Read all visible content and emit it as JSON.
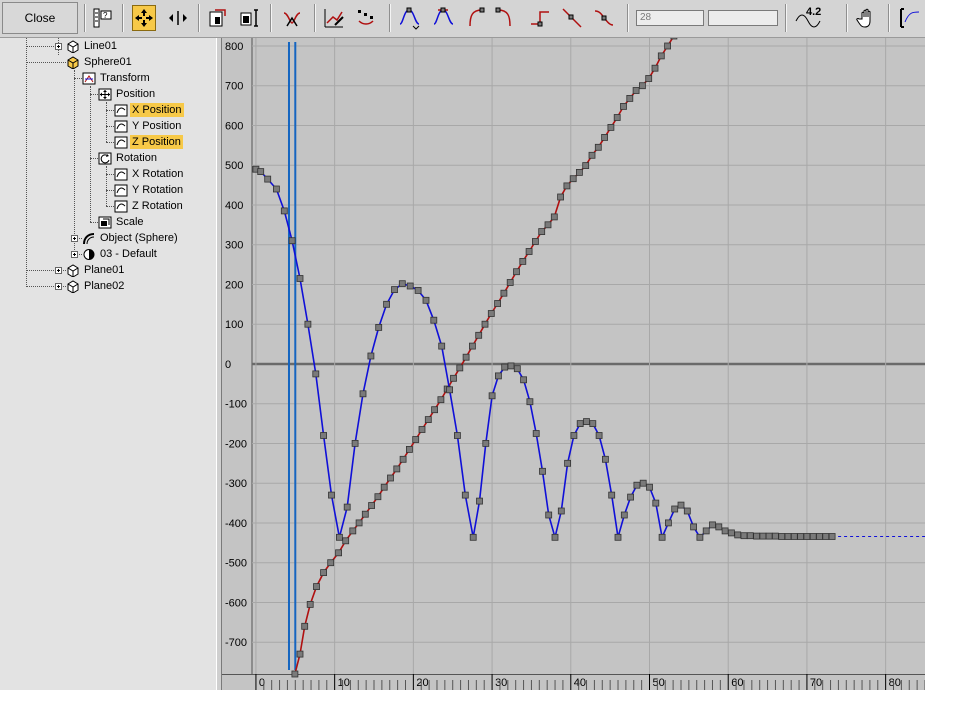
{
  "toolbar": {
    "close_label": "Close",
    "frame_field_value": "28",
    "value_field_value": "",
    "bounce_value": "4.2"
  },
  "tree": {
    "items": [
      {
        "label": "Line01",
        "selected": false
      },
      {
        "label": "Sphere01",
        "selected": false
      },
      {
        "label": "Transform",
        "selected": false
      },
      {
        "label": "Position",
        "selected": false
      },
      {
        "label": "X Position",
        "selected": true
      },
      {
        "label": "Y Position",
        "selected": false
      },
      {
        "label": "Z Position",
        "selected": true
      },
      {
        "label": "Rotation",
        "selected": false
      },
      {
        "label": "X Rotation",
        "selected": false
      },
      {
        "label": "Y Rotation",
        "selected": false
      },
      {
        "label": "Z Rotation",
        "selected": false
      },
      {
        "label": "Scale",
        "selected": false
      },
      {
        "label": "Object (Sphere)",
        "selected": false
      },
      {
        "label": "03 - Default",
        "selected": false
      },
      {
        "label": "Plane01",
        "selected": false
      },
      {
        "label": "Plane02",
        "selected": false
      }
    ]
  },
  "chart_data": {
    "type": "line",
    "xlim": [
      -0.5,
      85
    ],
    "ylim": [
      -780,
      820
    ],
    "x_ticks": [
      0,
      10,
      20,
      30,
      40,
      50,
      60,
      70,
      80
    ],
    "y_ticks": [
      800,
      700,
      600,
      500,
      400,
      300,
      200,
      100,
      0,
      -100,
      -200,
      -300,
      -400,
      -500,
      -600,
      -700
    ],
    "time_slider_frames": [
      4.2,
      5.0
    ],
    "colors": {
      "x_position": "#b01010",
      "z_position": "#1010d8",
      "key": "#7a7a7a",
      "time_line": "#1565c0"
    },
    "series": [
      {
        "key": "x_position",
        "x": [
          4.95,
          5.6,
          6.2,
          6.9,
          7.7,
          8.6,
          9.5,
          10.5,
          11.4,
          12.3,
          13.1,
          13.9,
          14.7,
          15.5,
          16.3,
          17.1,
          17.9,
          18.7,
          19.5,
          20.3,
          21.1,
          21.9,
          22.7,
          23.5,
          24.3,
          25.1,
          25.9,
          26.7,
          27.5,
          28.3,
          29.1,
          29.9,
          30.7,
          31.5,
          32.3,
          33.1,
          33.9,
          34.7,
          35.5,
          36.3,
          37.1,
          37.9,
          38.7,
          39.5,
          40.3,
          41.1,
          41.9,
          42.7,
          43.5,
          44.3,
          45.1,
          45.9,
          46.7,
          47.5,
          48.3,
          49.1,
          49.9,
          50.7,
          51.5,
          52.3,
          53.1,
          53.9,
          54.7,
          55.5,
          56.3,
          57.1,
          57.9,
          58.4
        ],
        "y": [
          -780,
          -730,
          -660,
          -605,
          -560,
          -525,
          -500,
          -475,
          -445,
          -420,
          -400,
          -378,
          -356,
          -334,
          -310,
          -287,
          -264,
          -240,
          -215,
          -190,
          -165,
          -140,
          -115,
          -90,
          -63,
          -36,
          -10,
          17,
          45,
          72,
          100,
          127,
          152,
          178,
          205,
          232,
          258,
          283,
          308,
          333,
          350,
          370,
          420,
          448,
          466,
          482,
          499,
          525,
          545,
          570,
          595,
          620,
          648,
          668,
          688,
          700,
          718,
          744,
          775,
          800,
          825,
          850,
          875,
          900,
          925,
          950,
          975,
          990
        ]
      },
      {
        "key": "z_position",
        "x": [
          0,
          0.6,
          1.5,
          2.6,
          3.6,
          4.6,
          5.6,
          6.6,
          7.6,
          8.6,
          9.6,
          10.6,
          11.6,
          12.6,
          13.6,
          14.6,
          15.6,
          16.6,
          17.6,
          18.6,
          19.6,
          20.6,
          21.6,
          22.6,
          23.6,
          24.6,
          25.6,
          26.6,
          27.6,
          28.4,
          29.2,
          30.0,
          30.8,
          31.6,
          32.4,
          33.2,
          34.0,
          34.8,
          35.6,
          36.4,
          37.2,
          38.0,
          38.8,
          39.6,
          40.4,
          41.2,
          42.0,
          42.8,
          43.6,
          44.4,
          45.2,
          46.0,
          46.8,
          47.6,
          48.4,
          49.2,
          50.0,
          50.8,
          51.6,
          52.4,
          53.2,
          54.0,
          54.8,
          55.6,
          56.4,
          57.2,
          58.0,
          58.8,
          59.6,
          60.4,
          61.2,
          62.0,
          62.8,
          63.6,
          64.4,
          65.2,
          66.0,
          66.8,
          67.6,
          68.4,
          69.2,
          70.0,
          70.8,
          71.6,
          72.4,
          73.2,
          85
        ],
        "y": [
          490,
          484,
          465,
          440,
          385,
          310,
          215,
          100,
          -25,
          -180,
          -330,
          -436,
          -360,
          -200,
          -75,
          20,
          92,
          150,
          187,
          202,
          196,
          185,
          160,
          110,
          45,
          -65,
          -180,
          -330,
          -436,
          -345,
          -200,
          -80,
          -30,
          -8,
          -5,
          -12,
          -40,
          -95,
          -175,
          -270,
          -380,
          -436,
          -370,
          -250,
          -180,
          -150,
          -145,
          -150,
          -180,
          -240,
          -330,
          -436,
          -380,
          -335,
          -305,
          -300,
          -310,
          -350,
          -436,
          -400,
          -365,
          -355,
          -370,
          -410,
          -436,
          -420,
          -405,
          -410,
          -420,
          -425,
          -430,
          -432,
          -432,
          -433,
          -433,
          -433,
          -433,
          -434,
          -434,
          -434,
          -434,
          -434,
          -434,
          -434,
          -434,
          -434,
          -434
        ],
        "dashed_after": 73.2
      }
    ]
  }
}
